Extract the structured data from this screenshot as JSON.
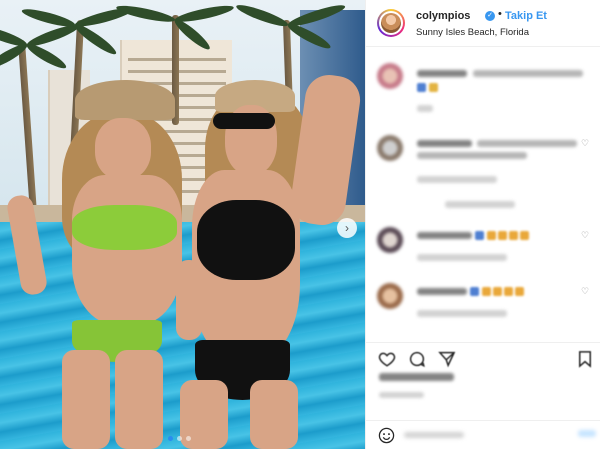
{
  "header": {
    "username": "colympios",
    "separator": "•",
    "follow_label": "Takip Et",
    "location": "Sunny Isles Beach, Florida",
    "verified_icon": "check-icon"
  },
  "photo": {
    "next_icon": "chevron-right-icon",
    "next_glyph": "›",
    "slide_count": 3,
    "active_slide": 1
  },
  "actions": {
    "like_icon": "heart-icon",
    "comment_icon": "comment-icon",
    "share_icon": "share-icon",
    "save_icon": "bookmark-icon"
  },
  "add_comment": {
    "emoji_icon": "smile-icon"
  },
  "colors": {
    "accent": "#3897f0",
    "text": "#262626",
    "muted": "#8e8e8e",
    "border": "#efefef"
  }
}
